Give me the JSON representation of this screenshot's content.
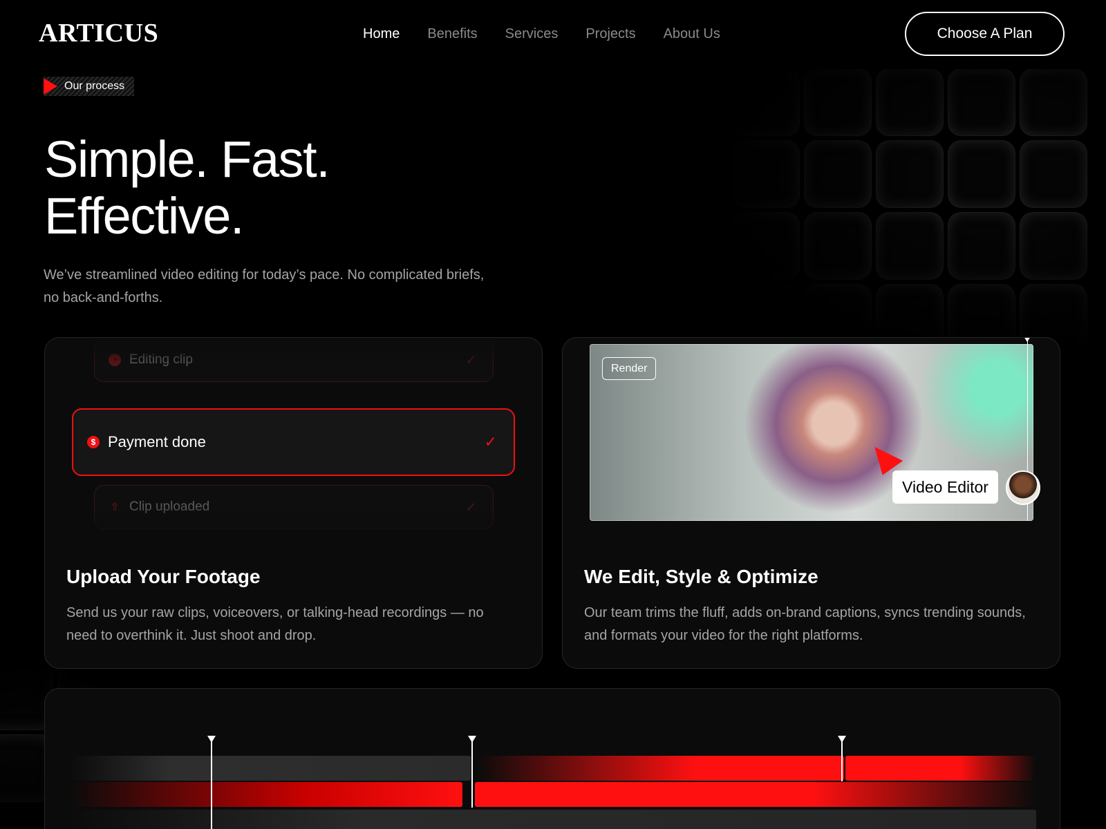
{
  "brand": {
    "logo_text": "ARTICUS"
  },
  "nav": {
    "items": [
      {
        "label": "Home",
        "active": true
      },
      {
        "label": "Benefits",
        "active": false
      },
      {
        "label": "Services",
        "active": false
      },
      {
        "label": "Projects",
        "active": false
      },
      {
        "label": "About Us",
        "active": false
      }
    ],
    "cta_label": "Choose A Plan"
  },
  "hero": {
    "badge": "Our process",
    "title_line1": "Simple. Fast.",
    "title_line2": "Effective.",
    "lead": "We’ve streamlined video editing for today’s pace. No complicated briefs, no back-and-forths."
  },
  "cards": [
    {
      "title": "Upload Your Footage",
      "desc": "Send us your raw clips, voiceovers, or talking-head recordings — no need to overthink it. Just shoot and drop.",
      "steps": [
        {
          "label": "Editing clip",
          "icon": "pie-chart-icon",
          "state": "done"
        },
        {
          "label": "Payment done",
          "icon": "dollar-icon",
          "state": "active"
        },
        {
          "label": "Clip uploaded",
          "icon": "upload-icon",
          "state": "done"
        }
      ]
    },
    {
      "title": "We Edit, Style & Optimize",
      "desc": "Our team trims the fluff, adds on-brand captions, syncs trending sounds, and formats your video for the right platforms.",
      "render_tag": "Render",
      "editor_tag": "Video Editor"
    }
  ],
  "colors": {
    "accent": "#ff1010",
    "background": "#000000",
    "card": "#0b0b0b",
    "muted_text": "#a5a5a5"
  }
}
